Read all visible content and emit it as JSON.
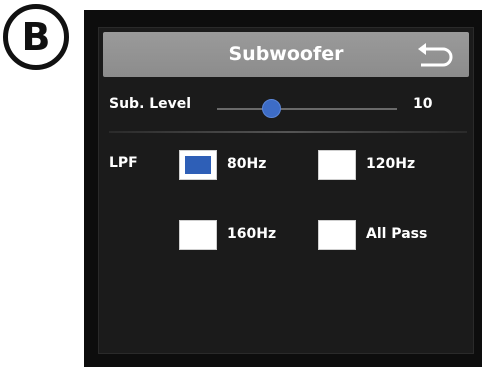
{
  "badge": {
    "letter": "B"
  },
  "header": {
    "title": "Subwoofer",
    "back_icon": "return-arrow-icon"
  },
  "sub_level": {
    "label": "Sub. Level",
    "value": "10",
    "slider_position": 0.3
  },
  "lpf": {
    "label": "LPF",
    "options": [
      {
        "label": "80Hz",
        "checked": true
      },
      {
        "label": "120Hz",
        "checked": false
      },
      {
        "label": "160Hz",
        "checked": false
      },
      {
        "label": "All Pass",
        "checked": false
      }
    ]
  },
  "colors": {
    "accent": "#2e5fb7",
    "titlebar": "#929292",
    "screen_bg": "#1b1b1b"
  }
}
